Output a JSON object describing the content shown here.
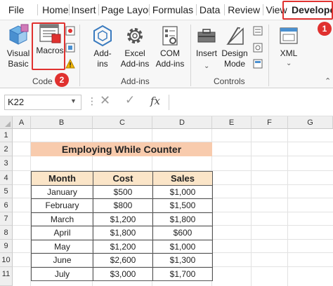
{
  "tabs": [
    "File",
    "Home",
    "Insert",
    "Page Layou",
    "Formulas",
    "Data",
    "Review",
    "View",
    "Developer"
  ],
  "ribbon": {
    "code": {
      "visual_basic_line1": "Visual",
      "visual_basic_line2": "Basic",
      "macros_label": "Macros",
      "group_label": "Code"
    },
    "addins": {
      "addins_line1": "Add-",
      "addins_line2": "ins",
      "excel_line1": "Excel",
      "excel_line2": "Add-ins",
      "com_line1": "COM",
      "com_line2": "Add-ins",
      "group_label": "Add-ins"
    },
    "controls": {
      "insert_label": "Insert",
      "design_line1": "Design",
      "design_line2": "Mode",
      "group_label": "Controls"
    },
    "xml": {
      "xml_label": "XML"
    }
  },
  "badges": {
    "developer": "1",
    "macros": "2"
  },
  "formula_bar": {
    "name_box": "K22",
    "fx": "fx",
    "value": ""
  },
  "columns": [
    "A",
    "B",
    "C",
    "D",
    "E",
    "F",
    "G"
  ],
  "rows": [
    "1",
    "2",
    "3",
    "4",
    "5",
    "6",
    "7",
    "8",
    "9",
    "10",
    "11"
  ],
  "sheet": {
    "title": "Employing While Counter",
    "headers": [
      "Month",
      "Cost",
      "Sales"
    ],
    "data": [
      [
        "January",
        "$500",
        "$1,000"
      ],
      [
        "February",
        "$800",
        "$1,500"
      ],
      [
        "March",
        "$1,200",
        "$1,800"
      ],
      [
        "April",
        "$1,800",
        "$600"
      ],
      [
        "May",
        "$1,200",
        "$1,000"
      ],
      [
        "June",
        "$2,600",
        "$1,300"
      ],
      [
        "July",
        "$3,000",
        "$1,700"
      ]
    ]
  },
  "colors": {
    "accent_red": "#e0312f",
    "title_fill": "#f8cbad",
    "header_fill": "#fbe5c8"
  }
}
